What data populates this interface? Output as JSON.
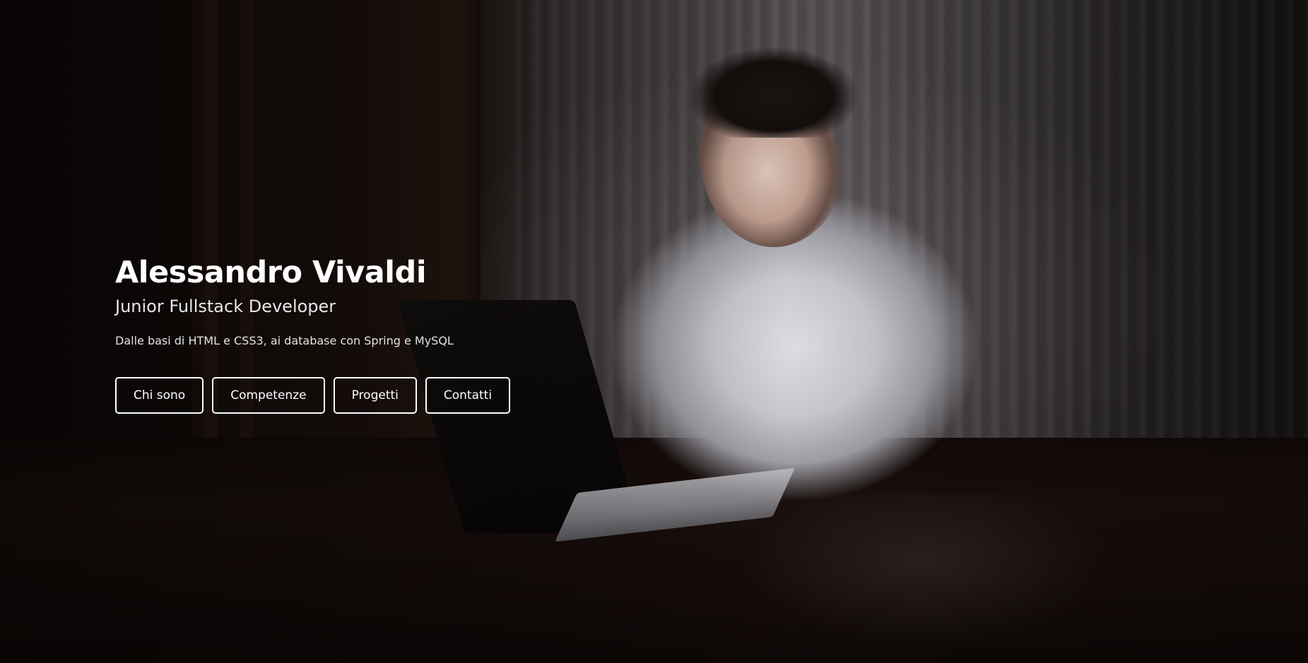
{
  "hero": {
    "name": "Alessandro Vivaldi",
    "role": "Junior Fullstack Developer",
    "tagline": "Dalle basi di HTML e CSS3, ai database con Spring e MySQL"
  },
  "nav_buttons": [
    {
      "label": "Chi sono"
    },
    {
      "label": "Competenze"
    },
    {
      "label": "Progetti"
    },
    {
      "label": "Contatti"
    }
  ],
  "colors": {
    "text": "#ffffff",
    "button_border": "#ffffff",
    "background_dark": "#0a0606"
  }
}
